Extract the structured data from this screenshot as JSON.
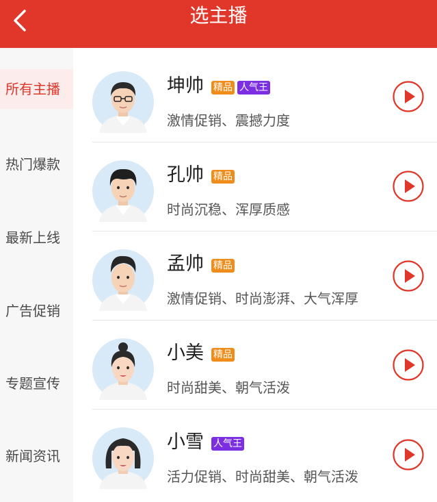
{
  "header": {
    "title": "选主播",
    "background_color": "#e0372a"
  },
  "sidebar": {
    "items": [
      {
        "label": "所有主播",
        "active": true
      },
      {
        "label": "热门爆款",
        "active": false
      },
      {
        "label": "最新上线",
        "active": false
      },
      {
        "label": "广告促销",
        "active": false
      },
      {
        "label": "专题宣传",
        "active": false
      },
      {
        "label": "新闻资讯",
        "active": false
      }
    ],
    "active_color": "#e0372a"
  },
  "anchors": [
    {
      "name": "坤帅",
      "badges": [
        {
          "type": "premium",
          "label": "精品"
        },
        {
          "type": "popular",
          "label": "人气王"
        }
      ],
      "description": "激情促销、震撼力度",
      "gender": "male",
      "glasses": true
    },
    {
      "name": "孔帅",
      "badges": [
        {
          "type": "premium",
          "label": "精品"
        }
      ],
      "description": "时尚沉稳、浑厚质感",
      "gender": "male",
      "glasses": false
    },
    {
      "name": "孟帅",
      "badges": [
        {
          "type": "premium",
          "label": "精品"
        }
      ],
      "description": "激情促销、时尚澎湃、大气浑厚",
      "gender": "male",
      "glasses": false
    },
    {
      "name": "小美",
      "badges": [
        {
          "type": "premium",
          "label": "精品"
        }
      ],
      "description": "时尚甜美、朝气活泼",
      "gender": "female",
      "glasses": false
    },
    {
      "name": "小雪",
      "badges": [
        {
          "type": "popular",
          "label": "人气王"
        }
      ],
      "description": "活力促销、时尚甜美、朝气活泼",
      "gender": "female",
      "glasses": false
    }
  ],
  "colors": {
    "premium_badge": "#f08c1a",
    "popular_badge": "#7b2fe0",
    "play_icon": "#e0372a"
  },
  "icons": {
    "back": "chevron-left-icon",
    "play": "play-circle-icon"
  }
}
